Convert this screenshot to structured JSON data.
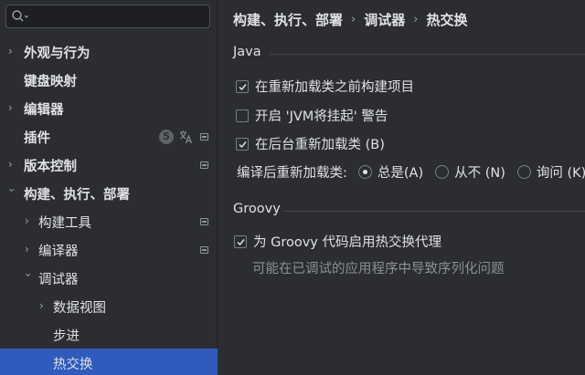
{
  "search": {
    "value": "",
    "placeholder": ""
  },
  "sidebar": {
    "items": [
      {
        "label": "外观与行为"
      },
      {
        "label": "键盘映射"
      },
      {
        "label": "编辑器"
      },
      {
        "label": "插件",
        "badge": "5"
      },
      {
        "label": "版本控制"
      },
      {
        "label": "构建、执行、部署"
      },
      {
        "label": "构建工具"
      },
      {
        "label": "编译器"
      },
      {
        "label": "调试器"
      },
      {
        "label": "数据视图"
      },
      {
        "label": "步进"
      },
      {
        "label": "热交换"
      }
    ]
  },
  "breadcrumb": [
    "构建、执行、部署",
    "调试器",
    "热交换"
  ],
  "breadcrumb_sep": "›",
  "java": {
    "title": "Java",
    "options": [
      {
        "label": "在重新加载类之前构建项目",
        "checked": true
      },
      {
        "label": "开启 'JVM将挂起' 警告",
        "checked": false
      },
      {
        "label": "在后台重新加载类 (B)",
        "checked": true
      }
    ],
    "reload_label": "编译后重新加载类:",
    "reload_choices": [
      {
        "label": "总是(A)",
        "selected": true
      },
      {
        "label": "从不 (N)",
        "selected": false
      },
      {
        "label": "询问 (K)",
        "selected": false
      }
    ]
  },
  "groovy": {
    "title": "Groovy",
    "option": {
      "label": "为 Groovy 代码启用热交换代理",
      "checked": true
    },
    "hint": "可能在已调试的应用程序中导致序列化问题"
  },
  "colors": {
    "selection": "#2e5bbd",
    "background": "#2b2d30",
    "text": "#dfe1e5",
    "muted": "#8c8f96"
  }
}
